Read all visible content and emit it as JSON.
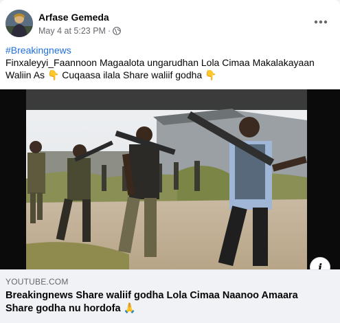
{
  "post": {
    "author": "Arfase Gemeda",
    "date": "May 4 at 5:23 PM",
    "separator": "·",
    "privacy_icon": "globe-icon",
    "more_icon": "more-horizontal-icon",
    "hashtag": "#Breakingnews",
    "body_line1": "Finxaleyyi_Faannoon Magaalota ungarudhan Lola Cimaa Makalakayaan",
    "body_line2": "Waliin As 👇 Cuqaasa ilala Share waliif godha 👇"
  },
  "media": {
    "type": "video-thumbnail",
    "info_button_label": "i"
  },
  "link_preview": {
    "domain": "YOUTUBE.COM",
    "title_line1": "Breakingnews Share waliif godha Lola Cimaa Naanoo Amaara",
    "title_line2": "Share godha nu hordofa 🙏"
  },
  "colors": {
    "link_blue": "#216fdb",
    "secondary_text": "#65676b",
    "preview_bg": "#f0f2f5"
  }
}
